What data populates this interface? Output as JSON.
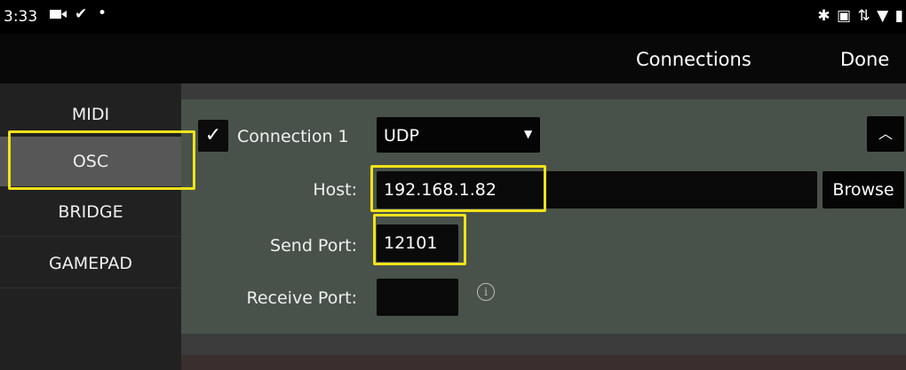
{
  "status_bar": {
    "time": "3:33",
    "left_icons": [
      "video-icon",
      "check-icon",
      "dot-icon"
    ],
    "right_icons": [
      "bluetooth-icon",
      "cast-icon",
      "data-arrows-icon",
      "wifi-icon",
      "battery-icon"
    ]
  },
  "header": {
    "title": "Connections",
    "done_label": "Done"
  },
  "sidebar": {
    "items": [
      {
        "label": "MIDI",
        "selected": false
      },
      {
        "label": "OSC",
        "selected": true
      },
      {
        "label": "BRIDGE",
        "selected": false
      },
      {
        "label": "GAMEPAD",
        "selected": false
      }
    ]
  },
  "connection": {
    "enabled_mark": "✓",
    "label": "Connection 1",
    "protocol": "UDP",
    "host_label": "Host:",
    "host_value": "192.168.1.82",
    "browse_label": "Browse",
    "send_port_label": "Send Port:",
    "send_port_value": "12101",
    "receive_port_label": "Receive Port:",
    "receive_port_value": ""
  },
  "colors": {
    "highlight": "#f2e21a",
    "panel": "#48524a",
    "selected_tab": "#575757"
  }
}
